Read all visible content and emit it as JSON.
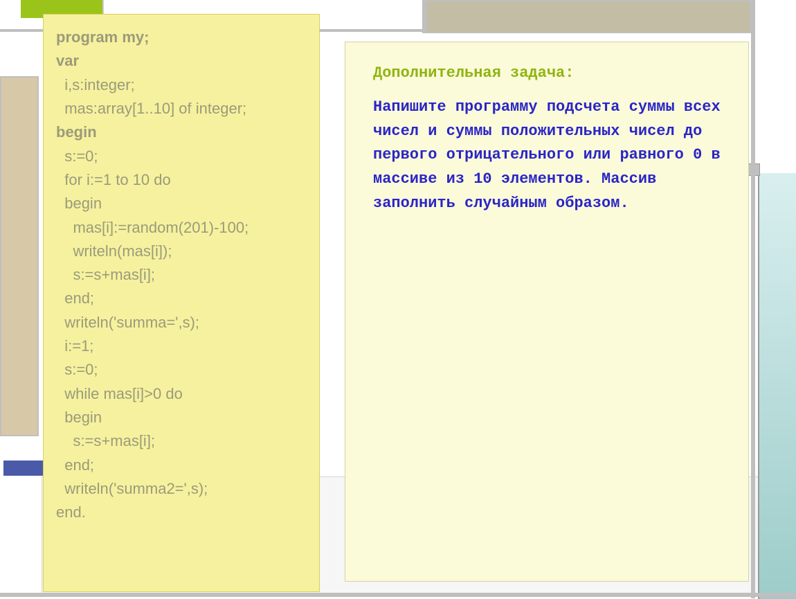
{
  "code": {
    "lines": [
      {
        "text": "program my;",
        "bold": true,
        "indent": 0
      },
      {
        "text": "var",
        "bold": true,
        "indent": 0
      },
      {
        "text": "i,s:integer;",
        "bold": false,
        "indent": 1
      },
      {
        "text": "mas:array[1..10] of integer;",
        "bold": false,
        "indent": 1
      },
      {
        "text": "begin",
        "bold": true,
        "indent": 0
      },
      {
        "text": "s:=0;",
        "bold": false,
        "indent": 1
      },
      {
        "text": "for i:=1 to 10 do",
        "bold": false,
        "indent": 1
      },
      {
        "text": "begin",
        "bold": false,
        "indent": 1
      },
      {
        "text": "mas[i]:=random(201)-100;",
        "bold": false,
        "indent": 2
      },
      {
        "text": "writeln(mas[i]);",
        "bold": false,
        "indent": 2
      },
      {
        "text": "s:=s+mas[i];",
        "bold": false,
        "indent": 2
      },
      {
        "text": "end;",
        "bold": false,
        "indent": 1
      },
      {
        "text": "writeln('summa=',s);",
        "bold": false,
        "indent": 1
      },
      {
        "text": "i:=1;",
        "bold": false,
        "indent": 1
      },
      {
        "text": "s:=0;",
        "bold": false,
        "indent": 1
      },
      {
        "text": "while mas[i]>0 do",
        "bold": false,
        "indent": 1
      },
      {
        "text": "begin",
        "bold": false,
        "indent": 1
      },
      {
        "text": "s:=s+mas[i];",
        "bold": false,
        "indent": 2
      },
      {
        "text": "end;",
        "bold": false,
        "indent": 1
      },
      {
        "text": "writeln('summa2=',s);",
        "bold": false,
        "indent": 1
      },
      {
        "text": "end.",
        "bold": false,
        "indent": 0
      }
    ]
  },
  "task": {
    "title": "Дополнительная задача:",
    "body": "Напишите программу подсчета суммы всех чисел и суммы положительных чисел до первого отрицательного или равного 0 в массиве из 10 элементов. Массив заполнить случайным образом."
  }
}
